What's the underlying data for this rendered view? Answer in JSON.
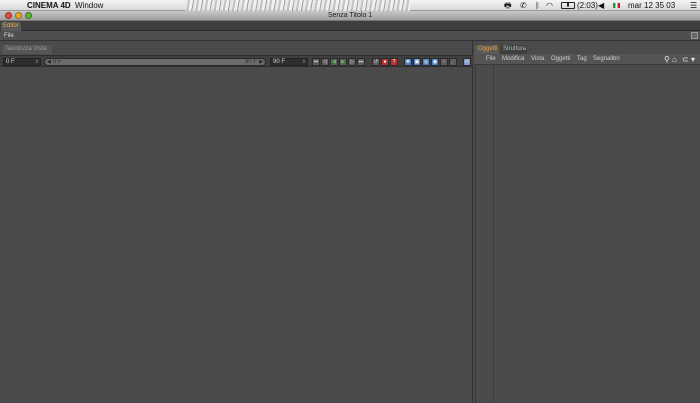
{
  "menubar": {
    "apple": "",
    "app_name": "CINEMA 4D",
    "window_menu": "Window",
    "battery": "(2:03)",
    "clock": "mar 12 35 03",
    "tray_icons": [
      "printer-icon",
      "phone-icon",
      "bluetooth-icon",
      "wifi-icon",
      "battery-icon",
      "volume-icon",
      "flag-icon",
      "menu-extra-icon"
    ]
  },
  "window": {
    "title": "Senza Titolo 1"
  },
  "editor_tab": "Editor",
  "file_menu": "File",
  "timeline": {
    "tab": "Tavolozza Vista",
    "start_field": "0 F",
    "slider_start": "0 F",
    "slider_end": "90 F",
    "end_field": "90 F"
  },
  "objects_panel": {
    "tabs": [
      "Oggetti",
      "Struttura"
    ],
    "menu": [
      "File",
      "Modifica",
      "Vista",
      "Oggetti",
      "Tag",
      "Segnalibri"
    ]
  },
  "colors": {
    "accent": "#f0a23a",
    "bg": "#4a4a4a"
  }
}
